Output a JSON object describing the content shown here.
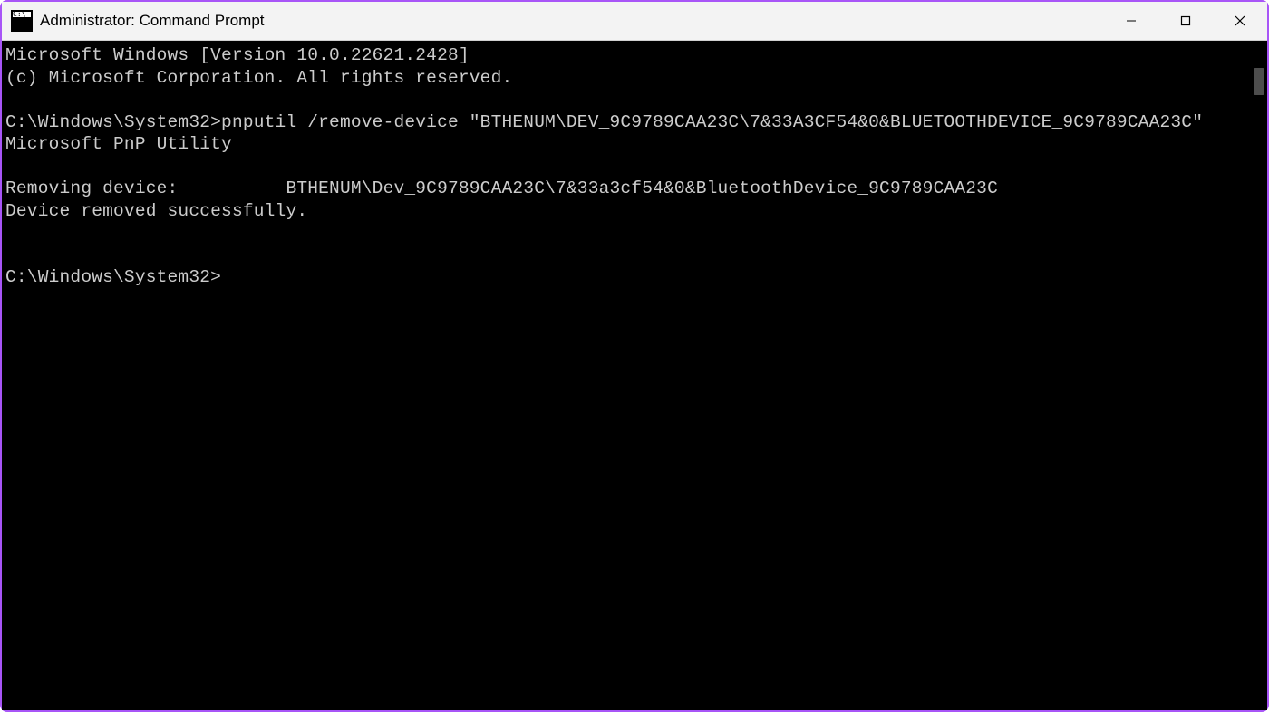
{
  "titlebar": {
    "title": "Administrator: Command Prompt"
  },
  "terminal": {
    "lines": [
      "Microsoft Windows [Version 10.0.22621.2428]",
      "(c) Microsoft Corporation. All rights reserved.",
      "",
      "C:\\Windows\\System32>pnputil /remove-device \"BTHENUM\\DEV_9C9789CAA23C\\7&33A3CF54&0&BLUETOOTHDEVICE_9C9789CAA23C\"",
      "Microsoft PnP Utility",
      "",
      "Removing device:          BTHENUM\\Dev_9C9789CAA23C\\7&33a3cf54&0&BluetoothDevice_9C9789CAA23C",
      "Device removed successfully.",
      "",
      "",
      "C:\\Windows\\System32>"
    ]
  }
}
